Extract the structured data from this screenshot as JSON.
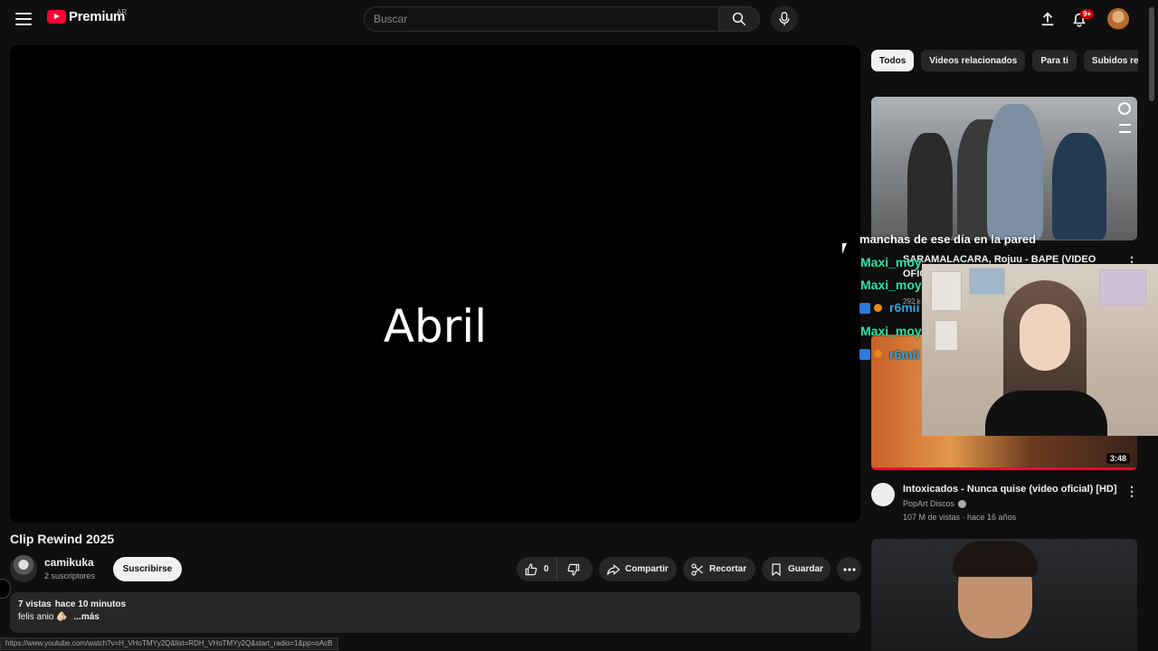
{
  "header": {
    "logo_text": "Premium",
    "country_code": "AR",
    "search_placeholder": "Buscar",
    "notification_count": "9+",
    "icons": [
      "menu-icon",
      "search-icon",
      "mic-icon",
      "upload-icon",
      "bell-icon"
    ]
  },
  "player": {
    "overlay_text": "Abril"
  },
  "video": {
    "title": "Clip Rewind 2025",
    "channel_name": "camikuka",
    "subscribers": "2 suscriptores",
    "subscribe_label": "Suscribirse",
    "like_count": "0",
    "share_label": "Compartir",
    "clip_label": "Recortar",
    "save_label": "Guardar",
    "views": "7 vistas",
    "published": "hace 10 minutos",
    "description": "felis anio 🫵🏻",
    "more_label": "...más"
  },
  "status_url": "https://www.youtube.com/watch?v=H_VHoTMYy2Q&list=RDH_VHoTMYy2Q&start_radio=1&pp=oAcB",
  "sidebar": {
    "chips": [
      "Todos",
      "Videos relacionados",
      "Para ti",
      "Subidos recientemente"
    ],
    "overlay_caption": "manchas de ese día en la pared",
    "item1": {
      "title_line1": "SARAMALACARA, Rojuu - BAPE (VIDEO",
      "title_line2": "OFIC",
      "views": "292 k"
    },
    "chat_overlay": [
      "Maxi_moy",
      "Maxi_moy",
      "r6mii",
      "Maxi_moy",
      "r6mii"
    ],
    "item2": {
      "title": "Intoxicados - Nunca quise (video oficial) [HD]",
      "channel": "PopArt Discos",
      "views": "107 M de vistas",
      "published": "hace 16 años",
      "duration": "3:48"
    }
  },
  "colors": {
    "background": "#0f0f0f",
    "brand_red": "#ff0033",
    "chat_green": "#2ee6a8",
    "chat_blue": "#2fa6e0"
  }
}
